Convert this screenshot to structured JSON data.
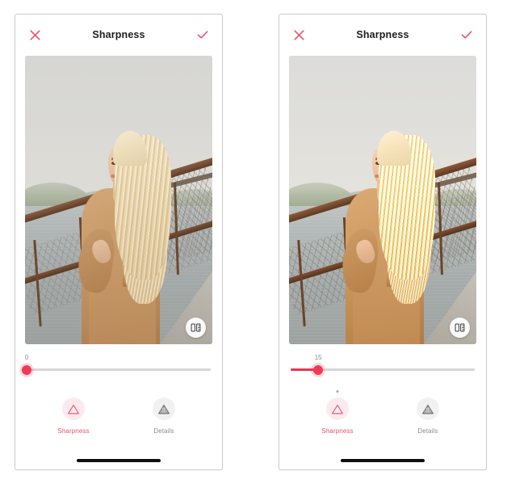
{
  "app": {
    "screen_title": "Sharpness",
    "platform": "ios"
  },
  "panels": [
    {
      "id": "before",
      "header": {
        "title": "Sharpness",
        "cancel_icon": "close-x-icon",
        "confirm_icon": "checkmark-icon"
      },
      "photo": {
        "description": "Woman with long blonde hair in tan coat leaning on railing by a lake",
        "compare_icon": "compare-split-icon",
        "sharpened": false
      },
      "slider": {
        "value": "0",
        "value_number": 0,
        "min": 0,
        "max": 100,
        "fill_percent": 0,
        "track_color": "#d6d6d6",
        "fill_color": "#e8364f",
        "thumb_color": "#ef3b55"
      },
      "tabs": [
        {
          "id": "sharpness",
          "label": "Sharpness",
          "icon": "triangle-outline-icon",
          "active": true,
          "modified": false
        },
        {
          "id": "details",
          "label": "Details",
          "icon": "triangle-hatched-icon",
          "active": false,
          "modified": false
        }
      ]
    },
    {
      "id": "after",
      "header": {
        "title": "Sharpness",
        "cancel_icon": "close-x-icon",
        "confirm_icon": "checkmark-icon"
      },
      "photo": {
        "description": "Woman with long blonde hair in tan coat leaning on railing by a lake, sharpened",
        "compare_icon": "compare-split-icon",
        "sharpened": true
      },
      "slider": {
        "value": "15",
        "value_number": 15,
        "min": 0,
        "max": 100,
        "fill_percent": 15,
        "track_color": "#d6d6d6",
        "fill_color": "#e8364f",
        "thumb_color": "#ef3b55"
      },
      "tabs": [
        {
          "id": "sharpness",
          "label": "Sharpness",
          "icon": "triangle-outline-icon",
          "active": true,
          "modified": true
        },
        {
          "id": "details",
          "label": "Details",
          "icon": "triangle-hatched-icon",
          "active": false,
          "modified": false
        }
      ]
    }
  ],
  "colors": {
    "accent": "#e8536d",
    "accent_strong": "#e8364f",
    "title": "#1d1d1f",
    "inactive": "#8c8c8c",
    "track": "#d6d6d6"
  }
}
